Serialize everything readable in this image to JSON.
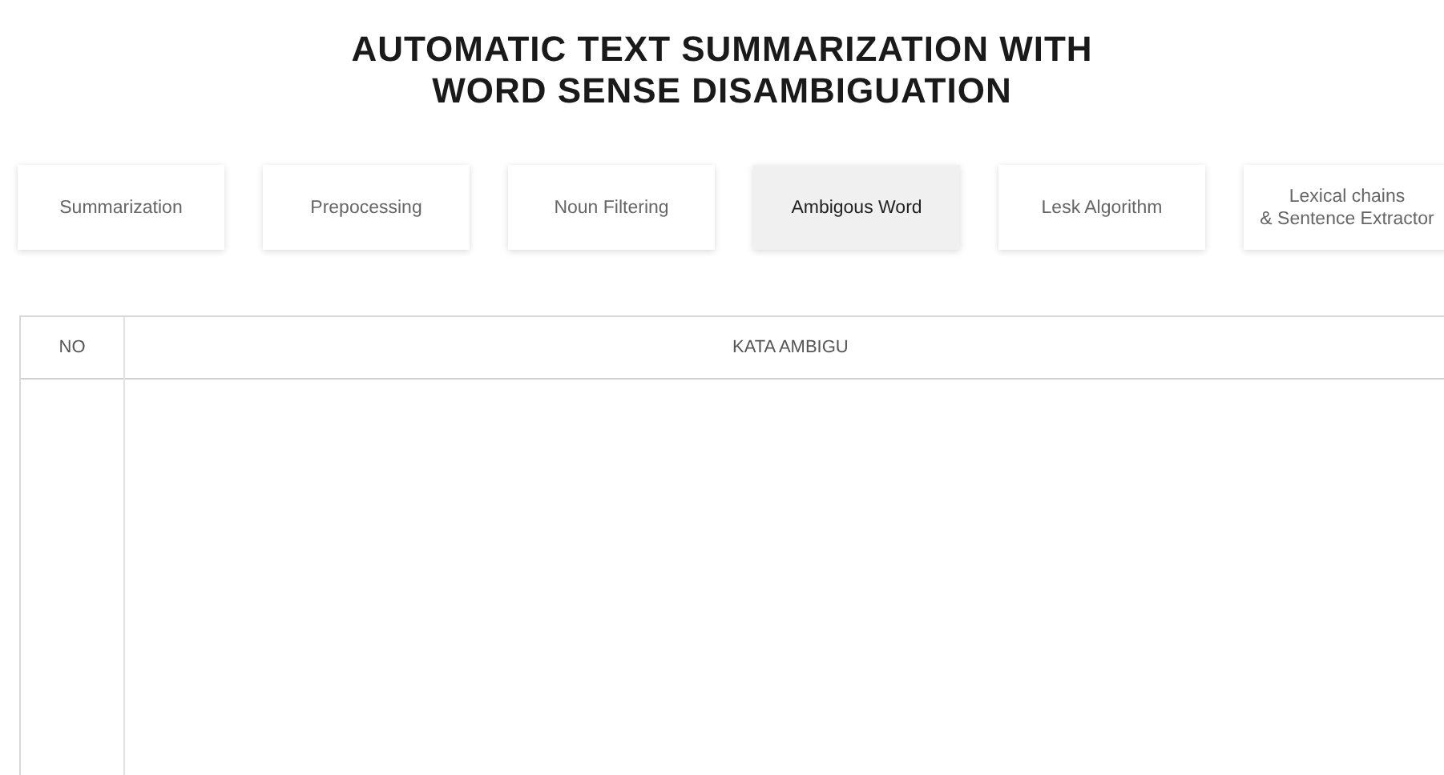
{
  "title": [
    "AUTOMATIC TEXT SUMMARIZATION WITH",
    "WORD SENSE DISAMBIGUATION"
  ],
  "tabs": [
    {
      "label": [
        "Summarization"
      ],
      "selected": false
    },
    {
      "label": [
        "Prepocessing"
      ],
      "selected": false
    },
    {
      "label": [
        "Noun Filtering"
      ],
      "selected": false
    },
    {
      "label": [
        "Ambigous Word"
      ],
      "selected": true
    },
    {
      "label": [
        "Lesk Algorithm"
      ],
      "selected": false
    },
    {
      "label": [
        "Lexical chains",
        "& Sentence Extractor"
      ],
      "selected": false
    }
  ],
  "table": {
    "columns": [
      "NO",
      "KATA AMBIGU"
    ]
  }
}
